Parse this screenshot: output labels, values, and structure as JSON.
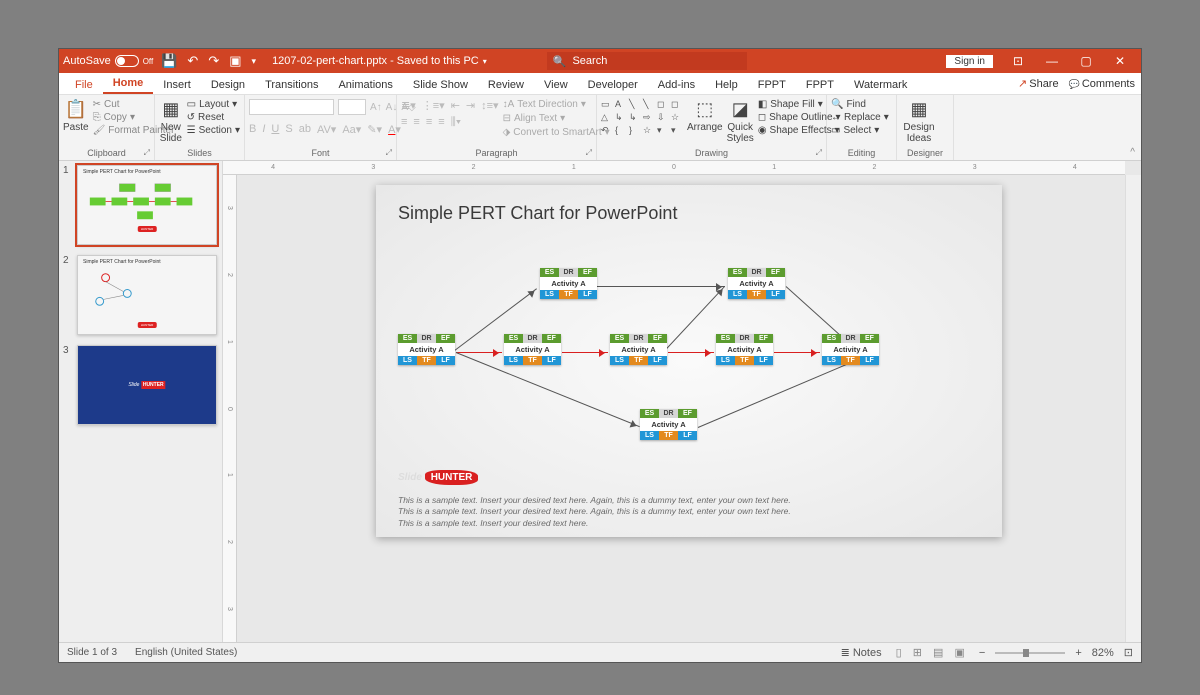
{
  "title": {
    "autosave": "AutoSave",
    "autosave_state": "Off",
    "doc": "1207-02-pert-chart.pptx - Saved to this PC",
    "search_label": "Search",
    "signin": "Sign in"
  },
  "tabs": {
    "file": "File",
    "home": "Home",
    "insert": "Insert",
    "design": "Design",
    "transitions": "Transitions",
    "animations": "Animations",
    "slideshow": "Slide Show",
    "review": "Review",
    "view": "View",
    "developer": "Developer",
    "addins": "Add-ins",
    "help": "Help",
    "fppt1": "FPPT",
    "fppt2": "FPPT",
    "watermark": "Watermark",
    "share": "Share",
    "comments": "Comments"
  },
  "ribbon": {
    "clipboard": {
      "label": "Clipboard",
      "paste": "Paste",
      "cut": "Cut",
      "copy": "Copy",
      "fmt": "Format Painter"
    },
    "slides": {
      "label": "Slides",
      "new": "New\nSlide",
      "layout": "Layout",
      "reset": "Reset",
      "section": "Section"
    },
    "font": {
      "label": "Font"
    },
    "paragraph": {
      "label": "Paragraph",
      "textdir": "Text Direction",
      "align": "Align Text",
      "smartart": "Convert to SmartArt"
    },
    "drawing": {
      "label": "Drawing",
      "arrange": "Arrange",
      "quick": "Quick\nStyles",
      "fill": "Shape Fill",
      "outline": "Shape Outline",
      "effects": "Shape Effects"
    },
    "editing": {
      "label": "Editing",
      "find": "Find",
      "replace": "Replace",
      "select": "Select"
    },
    "designer": {
      "label": "Designer",
      "ideas": "Design\nIdeas"
    }
  },
  "thumbs": {
    "t1": "Simple PERT Chart for PowerPoint",
    "t2": "Simple PERT Chart for PowerPoint",
    "t3_logo": "Slide HUNTER"
  },
  "slide": {
    "title": "Simple PERT Chart for PowerPoint",
    "node": {
      "es": "ES",
      "dr": "DR",
      "ef": "EF",
      "activity": "Activity A",
      "ls": "LS",
      "tf": "TF",
      "lf": "LF"
    },
    "logo_s": "Slide",
    "logo_h": "HUNTER",
    "sample1": "This is a sample text. Insert your desired text here. Again, this is a dummy text, enter your own text here.",
    "sample2": "This is a sample text. Insert your desired text here. Again, this is a dummy text, enter your own text here.",
    "sample3": "This is a sample text. Insert your desired text here."
  },
  "status": {
    "slide": "Slide 1 of 3",
    "lang": "English (United States)",
    "notes": "Notes",
    "zoom": "82%"
  },
  "ruler_h": [
    "4",
    "3",
    "2",
    "1",
    "0",
    "1",
    "2",
    "3",
    "4"
  ],
  "ruler_v": [
    "3",
    "2",
    "1",
    "0",
    "1",
    "2",
    "3"
  ]
}
